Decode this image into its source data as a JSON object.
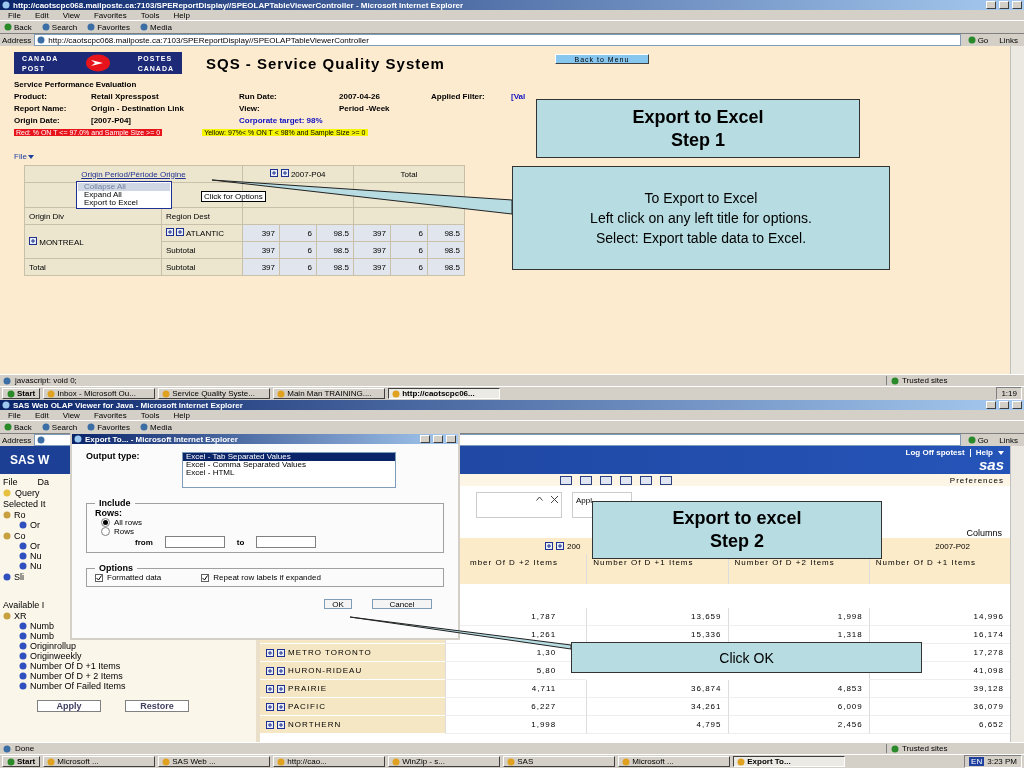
{
  "top_window": {
    "title": "http://caotscpc068.mailposte.ca:7103/SPEReportDisplay//SPEOLAPTableViewerController - Microsoft Internet Explorer",
    "menu": [
      "File",
      "Edit",
      "View",
      "Favorites",
      "Tools",
      "Help"
    ],
    "toolbar": [
      "Back",
      "Search",
      "Favorites",
      "Media"
    ],
    "address_label": "Address",
    "address": "http://caotscpc068.mailposte.ca:7103/SPEReportDisplay//SPEOLAPTableViewerController",
    "go": "Go",
    "links": "Links",
    "logo": {
      "left": [
        "CANADA",
        "POST"
      ],
      "right": [
        "POSTES",
        "CANADA"
      ]
    },
    "report_title": "SQS - Service Quality System",
    "back_button": "Back to Menu",
    "heading": "Service Performance Evaluation",
    "info_rows": [
      [
        {
          "kind": "label",
          "text": "Product:"
        },
        {
          "kind": "value",
          "text": "Retail Xpresspost"
        },
        {
          "kind": "label",
          "text": "Run Date:"
        },
        {
          "kind": "value",
          "text": "2007-04-26"
        },
        {
          "kind": "label",
          "text": "Applied Filter:"
        },
        {
          "kind": "link",
          "text": "[Val"
        }
      ],
      [
        {
          "kind": "label",
          "text": "Report Name:"
        },
        {
          "kind": "value",
          "text": "Origin - Destination Link"
        },
        {
          "kind": "label",
          "text": "View:"
        },
        {
          "kind": "value",
          "text": "Period -Week"
        }
      ],
      [
        {
          "kind": "label",
          "text": "Origin Date:"
        },
        {
          "kind": "value",
          "text": "[2007-P04]"
        },
        {
          "kind": "link",
          "text": "Corporate target: 98%"
        }
      ]
    ],
    "legends": [
      {
        "label": "Red:",
        "text": "% ON T <= 97.0% and Sample Size >= 0",
        "color": "#e8141c"
      },
      {
        "label": "Yellow:",
        "text": "97%< % ON T < 98% and Sample Size >= 0",
        "color": "#f5f500"
      }
    ],
    "file_menu": "File",
    "table": {
      "corner": "Origin Period/Période Origine",
      "groups": [
        "2007-P04",
        "Total"
      ],
      "dims": [
        "Origin Div",
        "Region Dest"
      ],
      "rows": [
        {
          "dim1": "MONTREAL",
          "dim2": "ATLANTIC",
          "expandable": true,
          "values": [
            "397",
            "6",
            "98.5",
            "397",
            "6",
            "98.5"
          ]
        },
        {
          "dim2": "Subtotal",
          "expandable": false,
          "values": [
            "397",
            "6",
            "98.5",
            "397",
            "6",
            "98.5"
          ]
        },
        {
          "dim1": "Total",
          "dim2": "Subtotal",
          "expandable": false,
          "values": [
            "397",
            "6",
            "98.5",
            "397",
            "6",
            "98.5"
          ]
        }
      ]
    },
    "options_menu": [
      {
        "label": "Collapse All",
        "selected": true
      },
      {
        "label": "Expand All",
        "selected": false
      },
      {
        "label": "Export to Excel",
        "selected": false
      }
    ],
    "tooltip": "Click for Options",
    "status": "javascript: void 0;",
    "zone": "Trusted sites",
    "taskbar": {
      "start": "Start",
      "items": [
        {
          "label": "Inbox - Microsoft Ou...",
          "selected": false
        },
        {
          "label": "Service Quality Syste...",
          "selected": false
        },
        {
          "label": "Main Man TRAINING....",
          "selected": false
        },
        {
          "label": "http://caotscpc06...",
          "selected": true
        }
      ],
      "clock": "1:19"
    }
  },
  "bottom_window": {
    "title": "SAS Web OLAP Viewer for Java - Microsoft Internet Explorer",
    "menu": [
      "File",
      "Edit",
      "View",
      "Favorites",
      "Tools",
      "Help"
    ],
    "toolbar": [
      "Back",
      "Search",
      "Favorites",
      "Media"
    ],
    "address_label": "Address",
    "go": "Go",
    "links": "Links",
    "brand": "SAS W",
    "logoff": "Log Off spotest",
    "help": "Help",
    "logo": "sas",
    "preferences": "Preferences",
    "sidebar": {
      "menu": [
        "File",
        "Da"
      ],
      "query_tab": "Query",
      "selected_label": "Selected It",
      "selected_tree": [
        {
          "label": "Ro",
          "children": [
            {
              "label": "Or"
            }
          ]
        },
        {
          "label": "Co",
          "children": [
            {
              "label": "Or"
            },
            {
              "label": "Nu"
            },
            {
              "label": "Nu"
            }
          ]
        },
        {
          "label": "Sli"
        }
      ],
      "available_label": "Available I",
      "available_tree": [
        {
          "label": "XR",
          "children": [
            {
              "label": "Numb"
            },
            {
              "label": "Numb"
            },
            {
              "label": "Originrollup"
            },
            {
              "label": "Originweekly"
            },
            {
              "label": "Number Of D +1 Items"
            },
            {
              "label": "Number Of D + 2 Items"
            },
            {
              "label": "Number Of Failed Items"
            }
          ]
        }
      ],
      "buttons": [
        "Apply",
        "Restore"
      ]
    },
    "filter_text": "Appl",
    "columns_label": "Columns",
    "groups": [
      "200",
      "2007-P02"
    ],
    "columns": [
      "mber Of D +2 Items",
      "Number Of D +1 Items",
      "Number Of D +2 Items",
      "Number Of D +1 Items"
    ],
    "rows": [
      {
        "values": [
          "1,787",
          "13,659",
          "1,998",
          "14,996"
        ]
      },
      {
        "values": [
          "1,261",
          "15,336",
          "1,318",
          "16,174"
        ]
      },
      {
        "kind": "partial",
        "label": "METRO TORONTO",
        "first": "1,30",
        "last": "17,278"
      },
      {
        "kind": "partial",
        "label": "HURON-RIDEAU",
        "first": "5,80",
        "last": "41,098"
      },
      {
        "label": "PRAIRIE",
        "values": [
          "4,711",
          "36,874",
          "4,853",
          "39,128"
        ]
      },
      {
        "label": "PACIFIC",
        "values": [
          "6,227",
          "34,261",
          "6,009",
          "36,079"
        ]
      },
      {
        "label": "NORTHERN",
        "values": [
          "1,998",
          "4,795",
          "2,456",
          "6,652"
        ]
      }
    ],
    "status": "Done",
    "zone": "Trusted sites",
    "taskbar": {
      "start": "Start",
      "items": [
        {
          "label": "Microsoft ...",
          "selected": false
        },
        {
          "label": "SAS Web ...",
          "selected": false
        },
        {
          "label": "http://cao...",
          "selected": false
        },
        {
          "label": "WinZip - s...",
          "selected": false
        },
        {
          "label": "SAS",
          "selected": false
        },
        {
          "label": "Microsoft ...",
          "selected": false
        },
        {
          "label": "Export To...",
          "selected": true
        }
      ],
      "lang": "EN",
      "clock": "3:23 PM"
    }
  },
  "dialog": {
    "title": "Export To... - Microsoft Internet Explorer",
    "output_label": "Output type:",
    "formats": [
      {
        "label": "Excel - Tab Separated Values",
        "selected": true
      },
      {
        "label": "Excel - Comma Separated Values",
        "selected": false
      },
      {
        "label": "Excel - HTML",
        "selected": false
      }
    ],
    "include_label": "Include",
    "rows_label": "Rows:",
    "row_options": [
      {
        "label": "All rows",
        "selected": true
      },
      {
        "label": "Rows",
        "selected": false
      }
    ],
    "from_label": "from",
    "to_label": "to",
    "options_label": "Options",
    "options": [
      {
        "label": "Formatted data",
        "checked": true
      },
      {
        "label": "Repeat row labels if expanded",
        "checked": true
      }
    ],
    "buttons": [
      "OK",
      "Cancel"
    ]
  },
  "callouts": [
    {
      "kind": "heading",
      "lines": [
        "Export to Excel",
        "Step 1"
      ]
    },
    {
      "kind": "note",
      "lines": [
        "To Export to Excel",
        "Left click on any left  title for options.",
        "Select: Export table data to Excel."
      ]
    },
    {
      "kind": "heading",
      "lines": [
        "Export to excel",
        "Step 2"
      ]
    },
    {
      "kind": "note",
      "lines": [
        "Click OK"
      ]
    }
  ]
}
